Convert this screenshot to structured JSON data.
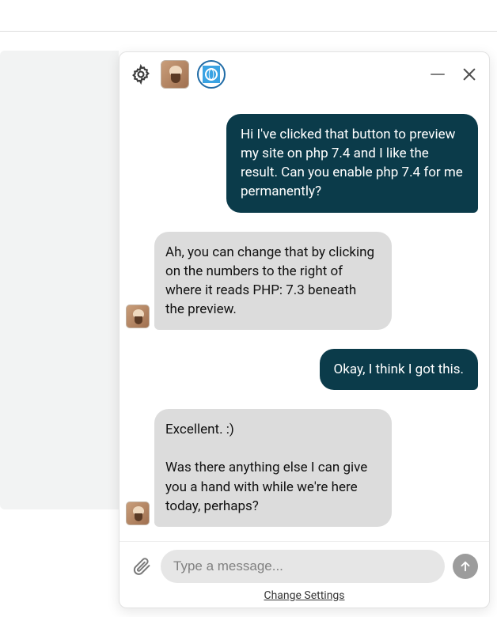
{
  "header": {
    "gear_label": "settings",
    "minimize_label": "minimize",
    "close_label": "close"
  },
  "messages": [
    {
      "role": "user",
      "text": "Hi I've clicked that button to preview my site on php 7.4 and I like the result. Can you enable php 7.4 for me permanently?"
    },
    {
      "role": "agent",
      "text": "Ah, you can change that by clicking on the numbers to the right of where it reads PHP: 7.3 beneath the preview."
    },
    {
      "role": "user",
      "text": "Okay, I think I got this."
    },
    {
      "role": "agent",
      "text": "Excellent. :)\n\nWas there anything else I can give you a hand with while we're here today, perhaps?"
    }
  ],
  "footer": {
    "input_placeholder": "Type a message...",
    "input_value": "",
    "settings_link": "Change Settings",
    "attach_label": "attach",
    "send_label": "send"
  },
  "colors": {
    "user_bubble": "#0b3b4a",
    "agent_bubble": "#dcdcdc"
  }
}
